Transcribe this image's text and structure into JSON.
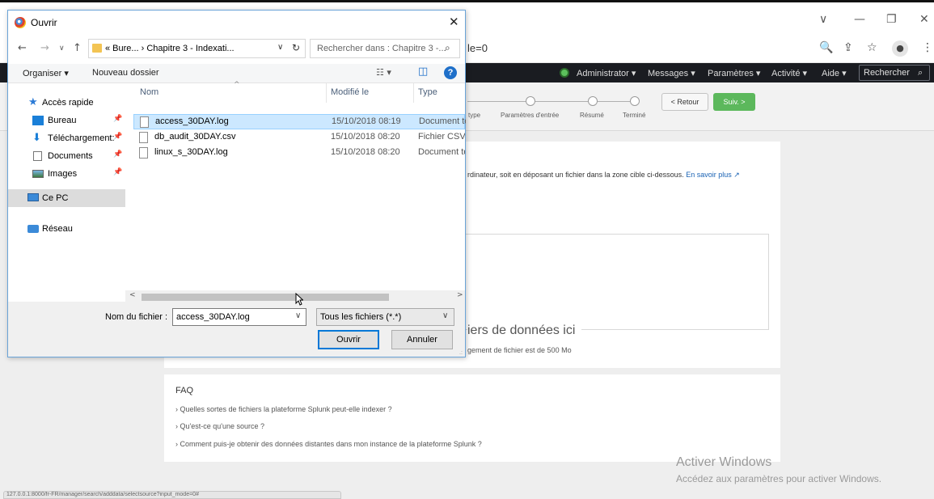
{
  "browser": {
    "url_fragment": "le=0",
    "window_controls": {
      "tab_list": "∨",
      "minimize": "—",
      "restore": "❐",
      "close": "✕"
    },
    "icons": {
      "zoom": "🔍",
      "share": "⇪",
      "star": "☆",
      "profile": "●",
      "menu": "⋮"
    }
  },
  "splunk_nav": {
    "items": [
      "Administrator ▾",
      "Messages ▾",
      "Paramètres ▾",
      "Activité ▾",
      "Aide ▾"
    ],
    "search_label": "Rechercher",
    "search_icon": "⌕"
  },
  "wizard": {
    "steps": [
      "type",
      "Paramètres d'entrée",
      "Résumé",
      "Terminé"
    ],
    "back_label": "< Retour",
    "next_label": "Suiv. >"
  },
  "upload": {
    "description": "rdinateur, soit en déposant un fichier dans la zone cible ci-dessous.",
    "learn_more": "En savoir plus ↗",
    "drop_title": "iers de données ici",
    "drop_subtitle": "gement de fichier est de 500 Mo"
  },
  "faq": {
    "title": "FAQ",
    "items": [
      "Quelles sortes de fichiers la plateforme Splunk peut-elle indexer ?",
      "Qu'est-ce qu'une source ?",
      "Comment puis-je obtenir des données distantes dans mon instance de la plateforme Splunk ?"
    ]
  },
  "activation": {
    "line1": "Activer Windows",
    "line2": "Accédez aux paramètres pour activer Windows."
  },
  "statusbar": {
    "text": "127.0.0.1:8000/fr-FR/manager/search/adddata/selectsource?input_mode=0#"
  },
  "dialog": {
    "title": "Ouvrir",
    "close": "✕",
    "nav": {
      "back": "←",
      "forward": "→",
      "dropdown": "∨",
      "up": "↑"
    },
    "breadcrumb": "« Bure...  ›  Chapitre 3 - Indexati...",
    "breadcrumb_dropdown": "∨",
    "refresh": "↻",
    "search_placeholder": "Rechercher dans : Chapitre 3 -...",
    "search_icon": "⌕",
    "toolbar": {
      "organize": "Organiser ▾",
      "new_folder": "Nouveau dossier",
      "view_icon": "☷ ▾",
      "pane_icon": "◫",
      "help": "?"
    },
    "sidebar": [
      {
        "label": "Accès rapide",
        "icon": "star-icon",
        "pinned": false
      },
      {
        "label": "Bureau",
        "icon": "desktop-icon",
        "pinned": true
      },
      {
        "label": "Téléchargement:",
        "icon": "download-icon",
        "pinned": true
      },
      {
        "label": "Documents",
        "icon": "documents-icon",
        "pinned": true
      },
      {
        "label": "Images",
        "icon": "images-icon",
        "pinned": true
      },
      {
        "label": "Ce PC",
        "icon": "computer-icon",
        "pinned": false
      },
      {
        "label": "Réseau",
        "icon": "network-icon",
        "pinned": false
      }
    ],
    "pin_glyph": "📌",
    "columns": {
      "name": "Nom",
      "modified": "Modifié le",
      "type": "Type",
      "sort_caret": "^"
    },
    "files": [
      {
        "name": "access_30DAY.log",
        "modified": "15/10/2018 08:19",
        "type": "Document texte"
      },
      {
        "name": "db_audit_30DAY.csv",
        "modified": "15/10/2018 08:20",
        "type": "Fichier CSV"
      },
      {
        "name": "linux_s_30DAY.log",
        "modified": "15/10/2018 08:20",
        "type": "Document texte"
      }
    ],
    "scroll_left": "<",
    "scroll_right": ">",
    "filename_label": "Nom du fichier :",
    "filename_value": "access_30DAY.log",
    "dropdown_glyph": "∨",
    "filter_value": "Tous les fichiers (*.*)",
    "open_label": "Ouvrir",
    "cancel_label": "Annuler",
    "grip": ".:"
  }
}
